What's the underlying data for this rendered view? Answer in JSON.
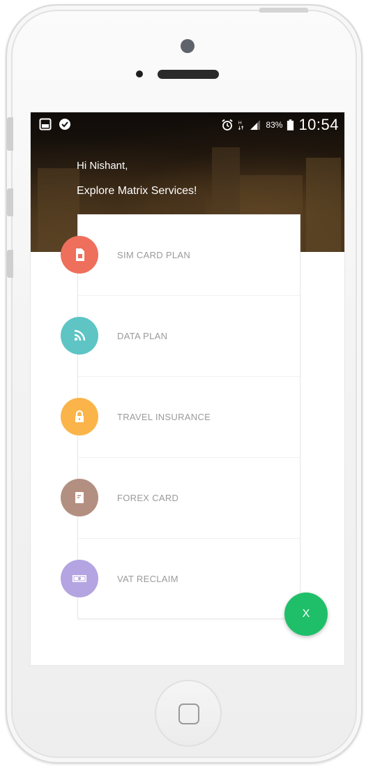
{
  "status_bar": {
    "battery_percent": "83%",
    "time": "10:54",
    "left_icons": [
      "gallery-notification-icon",
      "security-check-icon"
    ],
    "right_icons": [
      "alarm-icon",
      "data-signal-icon",
      "cell-signal-icon",
      "battery-icon"
    ]
  },
  "header": {
    "greeting": "Hi Nishant,",
    "subtitle": "Explore Matrix Services!"
  },
  "services": [
    {
      "label": "SIM CARD PLAN",
      "icon": "sim-card-icon",
      "color": "#ee6f5c"
    },
    {
      "label": "DATA PLAN",
      "icon": "wifi-signal-icon",
      "color": "#5ec4c4"
    },
    {
      "label": "TRAVEL INSURANCE",
      "icon": "lock-icon",
      "color": "#fbb44a"
    },
    {
      "label": "FOREX CARD",
      "icon": "card-icon",
      "color": "#b38f81"
    },
    {
      "label": "VAT RECLAIM",
      "icon": "money-icon",
      "color": "#b4a4e2"
    }
  ],
  "fab": {
    "label": "X",
    "color": "#1fbf69"
  }
}
